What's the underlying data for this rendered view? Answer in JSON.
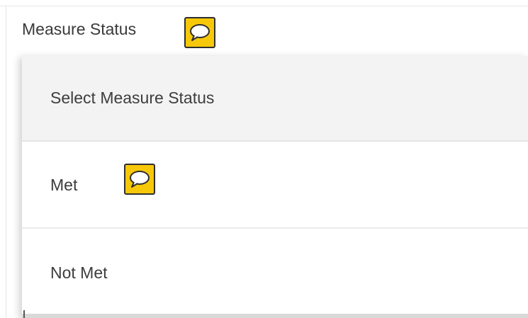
{
  "field": {
    "label": "Measure Status",
    "comment_icon": "speech-bubble-icon"
  },
  "dropdown": {
    "placeholder": "Select Measure Status",
    "options": [
      {
        "label": "Met",
        "comment_icon": "speech-bubble-icon"
      },
      {
        "label": "Not Met"
      }
    ]
  },
  "colors": {
    "comment_icon_bg": "#f7c80a",
    "header_bg": "#f3f3f3"
  }
}
